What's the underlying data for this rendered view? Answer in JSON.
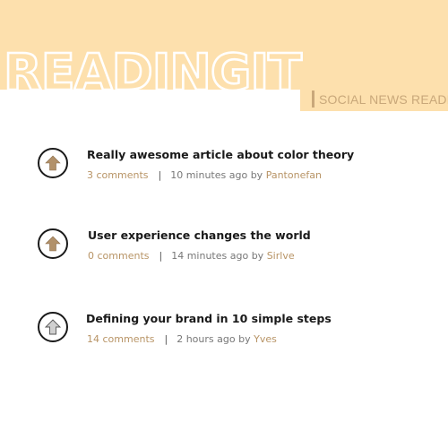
{
  "header": {
    "logo_text": "READINGIT",
    "tagline": "SOCIAL NEWS READER"
  },
  "colors": {
    "header_bg": "#fde0ad",
    "accent": "#b89466",
    "upvote_active": "#b2916a",
    "upvote_inactive": "#d0d0d0"
  },
  "articles": [
    {
      "title": "Really awesome article about color theory",
      "comments": "3 comments",
      "time": "10 minutes ago",
      "by": "by",
      "author": "Pantonefan",
      "vote_icon": "up-arrow-icon",
      "voted": true
    },
    {
      "title": "User experience changes the world",
      "comments": "0 comments",
      "time": "14 minutes ago",
      "by": "by",
      "author": "Sirlve",
      "vote_icon": "up-arrow-icon",
      "voted": true
    },
    {
      "title": "Defining your brand in 10 simple steps",
      "comments": "14 comments",
      "time": "2 hours ago",
      "by": "by",
      "author": "Yves",
      "vote_icon": "up-arrow-icon",
      "voted": false
    }
  ],
  "separator": "|"
}
